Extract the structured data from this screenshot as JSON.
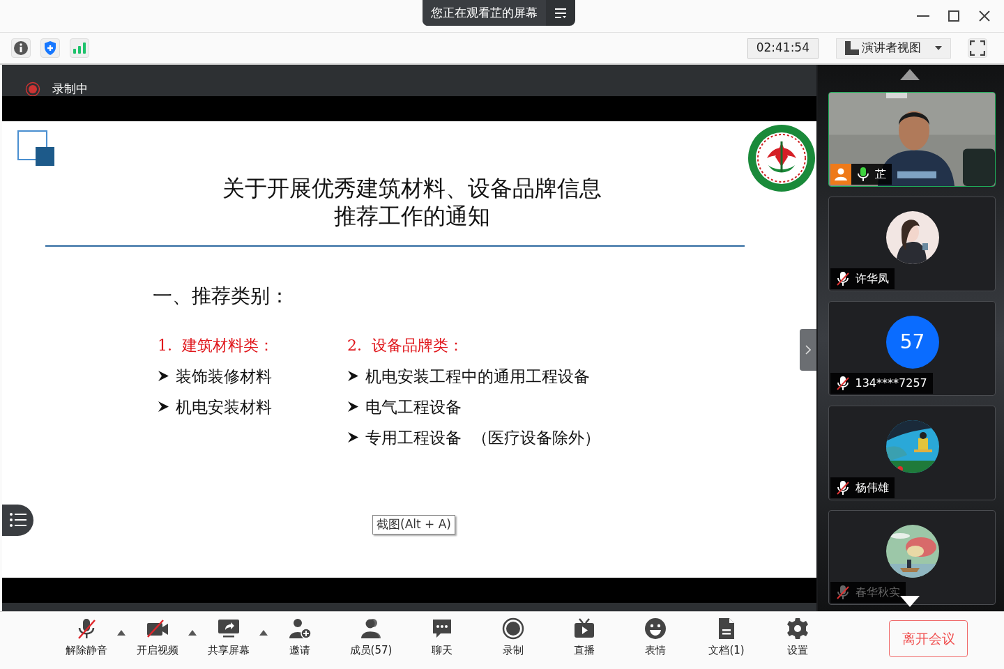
{
  "banner": {
    "text": "您正在观看芷的屏幕"
  },
  "toolbar": {
    "timer": "02:41:54",
    "view_selector": "演讲者视图"
  },
  "recording": {
    "label": "录制中"
  },
  "slide": {
    "title_lines": [
      "关于开展优秀建筑材料、设备品牌信息",
      "推荐工作的通知"
    ],
    "section": "一、推荐类别：",
    "columns": [
      {
        "heading": "1.  建筑材料类：",
        "items": [
          "装饰装修材料",
          "机电安装材料"
        ]
      },
      {
        "heading": "2.  设备品牌类：",
        "items": [
          "机电安装工程中的通用工程设备",
          "电气工程设备",
          "专用工程设备  （医疗设备除外）"
        ]
      }
    ]
  },
  "tooltip": "截图(Alt + A)",
  "participants": [
    {
      "kind": "video",
      "name": "芷",
      "muted": false,
      "host": true,
      "selected": true,
      "dimmed": false
    },
    {
      "kind": "avatar",
      "name": "许华凤",
      "muted": true,
      "host": false,
      "selected": false,
      "dimmed": false
    },
    {
      "kind": "number",
      "badge": "57",
      "name": "134****7257",
      "muted": true,
      "host": false,
      "selected": false,
      "dimmed": false
    },
    {
      "kind": "avatar",
      "name": "杨伟雄",
      "muted": true,
      "host": false,
      "selected": false,
      "dimmed": false
    },
    {
      "kind": "avatar",
      "name": "春华秋实",
      "muted": true,
      "host": false,
      "selected": false,
      "dimmed": true
    }
  ],
  "controls": [
    {
      "kind": "mute",
      "label": "解除静音",
      "has_menu": true
    },
    {
      "kind": "video",
      "label": "开启视频",
      "has_menu": true
    },
    {
      "kind": "share",
      "label": "共享屏幕",
      "has_menu": true
    },
    {
      "kind": "invite",
      "label": "邀请",
      "has_menu": false
    },
    {
      "kind": "members",
      "label": "成员(57)",
      "has_menu": false
    },
    {
      "kind": "chat",
      "label": "聊天",
      "has_menu": false
    },
    {
      "kind": "record",
      "label": "录制",
      "has_menu": false
    },
    {
      "kind": "live",
      "label": "直播",
      "has_menu": false
    },
    {
      "kind": "emoji",
      "label": "表情",
      "has_menu": false
    },
    {
      "kind": "document",
      "label": "文档(1)",
      "has_menu": false
    },
    {
      "kind": "settings",
      "label": "设置",
      "has_menu": false
    }
  ],
  "leave_button": "离开会议"
}
